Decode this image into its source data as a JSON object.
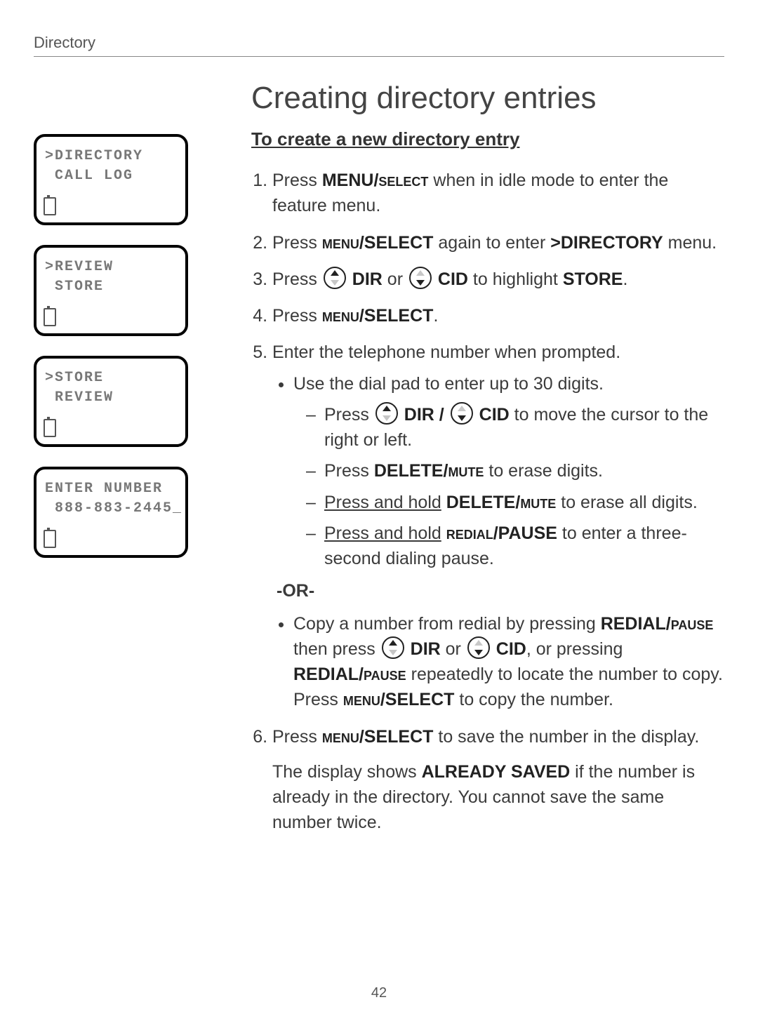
{
  "header": {
    "section": "Directory"
  },
  "title": "Creating directory entries",
  "subtitle": "To create a new directory entry",
  "lcd": {
    "p1": {
      "l1": ">DIRECTORY",
      "l2": " CALL LOG"
    },
    "p2": {
      "l1": ">REVIEW",
      "l2": " STORE"
    },
    "p3": {
      "l1": ">STORE",
      "l2": " REVIEW"
    },
    "p4": {
      "l1": "ENTER NUMBER",
      "l2": " 888-883-2445_"
    }
  },
  "steps": {
    "s1a": "Press ",
    "s1b": "MENU/",
    "s1c": "select",
    "s1d": " when in idle mode to enter the feature menu.",
    "s2a": "Press ",
    "s2b": "menu",
    "s2c": "/SELECT",
    "s2d": " again to enter ",
    "s2e": ">DIRECTORY",
    "s2f": " menu.",
    "s3a": "Press ",
    "s3b": " DIR",
    "s3c": " or ",
    "s3d": " CID",
    "s3e": " to highlight ",
    "s3f": "STORE",
    "s3g": ".",
    "s4a": "Press ",
    "s4b": "menu",
    "s4c": "/SELECT",
    "s4d": ".",
    "s5a": "Enter the telephone number when prompted.",
    "s5b1": "Use the dial pad to enter up to 30 digits.",
    "s5c1a": "Press ",
    "s5c1b": " DIR / ",
    "s5c1c": " CID",
    "s5c1d": " to move the cursor to the right or left.",
    "s5c2a": "Press ",
    "s5c2b": "DELETE/",
    "s5c2c": "mute",
    "s5c2d": " to erase digits.",
    "s5c3a": "Press and hold",
    "s5c3b": " ",
    "s5c3c": "DELETE/",
    "s5c3d": "mute",
    "s5c3e": " to erase all digits.",
    "s5c4a": "Press and hold",
    "s5c4b": " ",
    "s5c4c": "redial",
    "s5c4d": "/PAUSE",
    "s5c4e": " to enter a three-second dialing pause.",
    "or": "-OR-",
    "s5d1a": "Copy a number from redial by pressing ",
    "s5d1b": "REDIAL/",
    "s5d1c": "pause",
    "s5d1d": " then press ",
    "s5d1e": " DIR",
    "s5d1f": " or ",
    "s5d1g": " CID",
    "s5d1h": ", or pressing ",
    "s5d1i": "REDIAL/",
    "s5d1j": "pause",
    "s5d1k": " repeatedly to locate the number to copy. Press ",
    "s5d1l": "menu",
    "s5d1m": "/SELECT",
    "s5d1n": " to copy the number.",
    "s6a": "Press ",
    "s6b": "menu",
    "s6c": "/SELECT",
    "s6d": " to save the number in the display.",
    "s6e": "The display shows ",
    "s6f": "ALREADY SAVED",
    "s6g": " if the number is already in the directory. You cannot save the same number twice."
  },
  "pagenum": "42"
}
